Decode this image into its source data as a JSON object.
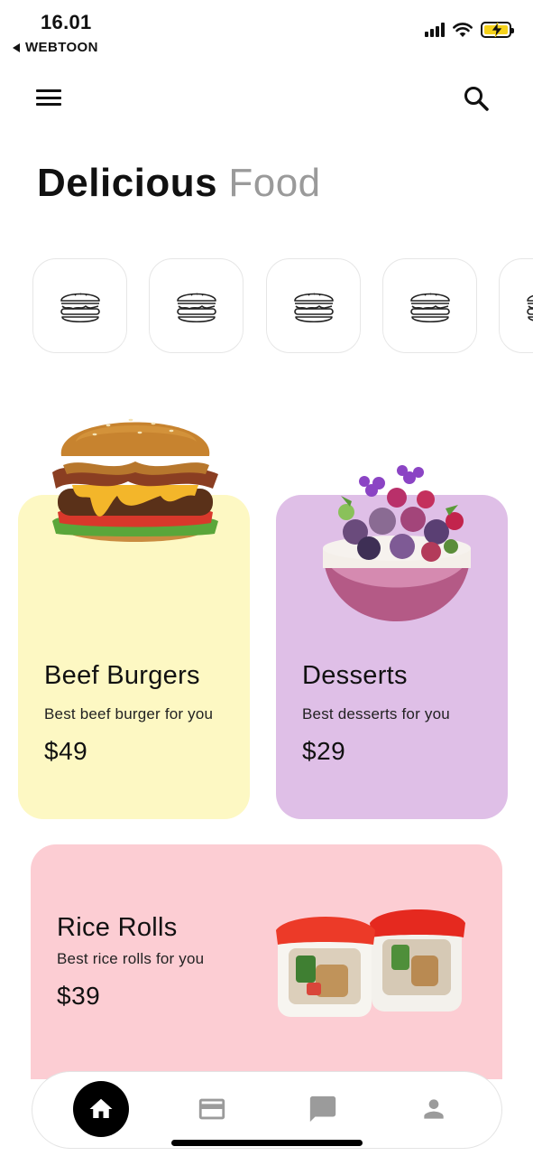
{
  "status_bar": {
    "time": "16.01",
    "back_app": "WEBTOON",
    "battery_color": "#f5d21a"
  },
  "header": {
    "menu_icon": "hamburger-menu-icon",
    "search_icon": "search-icon",
    "title_bold": "Delicious",
    "title_light": "Food"
  },
  "categories": [
    {
      "icon": "burger-icon"
    },
    {
      "icon": "burger-icon"
    },
    {
      "icon": "burger-icon"
    },
    {
      "icon": "burger-icon"
    },
    {
      "icon": "burger-icon"
    }
  ],
  "cards": {
    "burger": {
      "title": "Beef Burgers",
      "description": "Best beef burger for you",
      "price": "$49",
      "background": "#fdf8c3"
    },
    "dessert": {
      "title": "Desserts",
      "description": "Best desserts for you",
      "price": "$29",
      "background": "#dfbfe7"
    },
    "rolls": {
      "title": "Rice Rolls",
      "description": "Best rice rolls for you",
      "price": "$39",
      "background": "#fccdd3"
    }
  },
  "bottom_nav": [
    {
      "icon": "home-icon",
      "active": true
    },
    {
      "icon": "card-icon",
      "active": false
    },
    {
      "icon": "chat-icon",
      "active": false
    },
    {
      "icon": "profile-icon",
      "active": false
    }
  ]
}
